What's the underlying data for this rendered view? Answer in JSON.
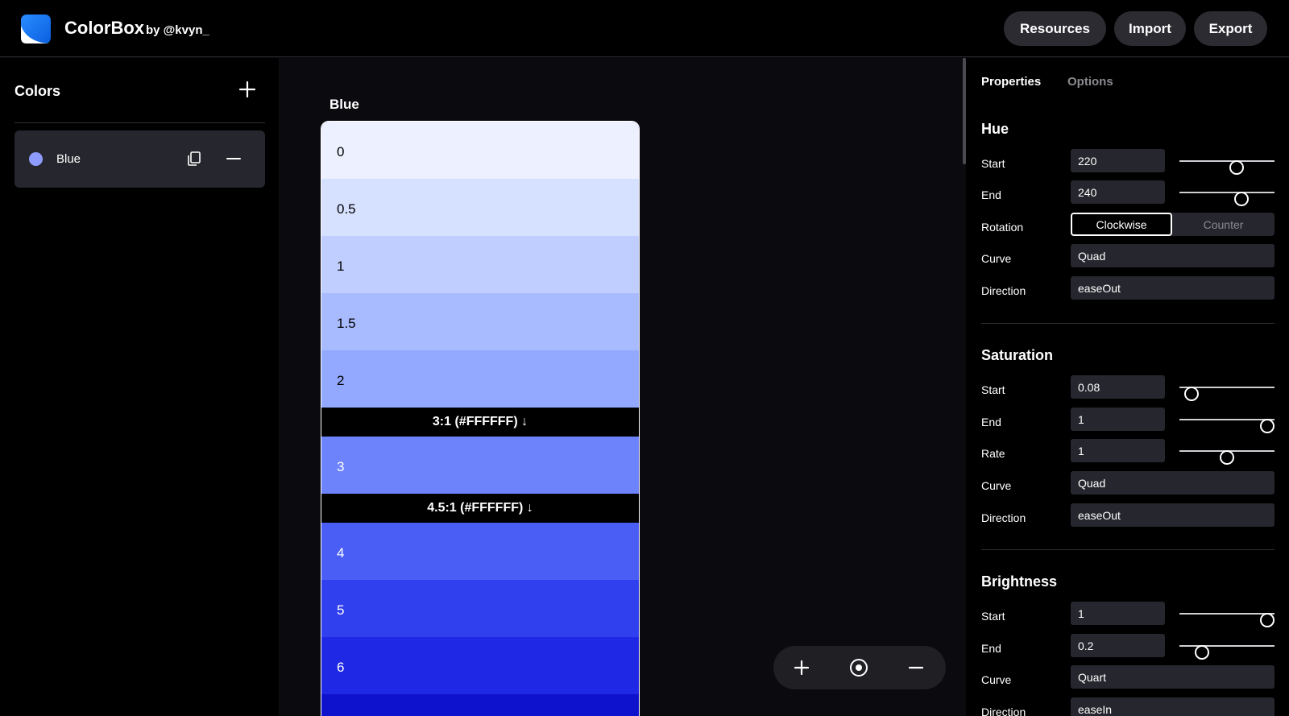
{
  "header": {
    "brand": "ColorBox",
    "byline": "by @kvyn_",
    "buttons": {
      "resources": "Resources",
      "import": "Import",
      "export": "Export"
    }
  },
  "sidebar": {
    "title": "Colors",
    "items": [
      {
        "label": "Blue",
        "dot_color": "#8f9cff"
      }
    ]
  },
  "canvas": {
    "palette_name": "Blue",
    "swatches": [
      {
        "label": "0",
        "color": "#edf1ff"
      },
      {
        "label": "0.5",
        "color": "#d6e0ff"
      },
      {
        "label": "1",
        "color": "#c0ceff"
      },
      {
        "label": "1.5",
        "color": "#a9bbff"
      },
      {
        "label": "2",
        "color": "#93a8ff"
      },
      {
        "label": "3",
        "color": "#6c83fb"
      },
      {
        "label": "4",
        "color": "#4a5ef5"
      },
      {
        "label": "5",
        "color": "#3140ee"
      },
      {
        "label": "6",
        "color": "#1f28e4"
      }
    ],
    "contrast_markers": {
      "three": "3:1 (#FFFFFF) ↓",
      "four_five": "4.5:1 (#FFFFFF) ↓"
    }
  },
  "panel": {
    "tabs": {
      "properties": "Properties",
      "options": "Options"
    },
    "labels": {
      "start": "Start",
      "end": "End",
      "rotation": "Rotation",
      "curve": "Curve",
      "direction": "Direction",
      "rate": "Rate"
    },
    "hue": {
      "title": "Hue",
      "start": "220",
      "end": "240",
      "start_pct": 0.6,
      "end_pct": 0.65,
      "rotation_on": "Clockwise",
      "rotation_off": "Counter",
      "curve": "Quad",
      "direction": "easeOut"
    },
    "saturation": {
      "title": "Saturation",
      "start": "0.08",
      "end": "1",
      "rate": "1",
      "start_pct": 0.13,
      "end_pct": 0.92,
      "rate_pct": 0.5,
      "curve": "Quad",
      "direction": "easeOut"
    },
    "brightness": {
      "title": "Brightness",
      "start": "1",
      "end": "0.2",
      "start_pct": 0.92,
      "end_pct": 0.24,
      "curve": "Quart",
      "direction": "easeIn"
    }
  }
}
